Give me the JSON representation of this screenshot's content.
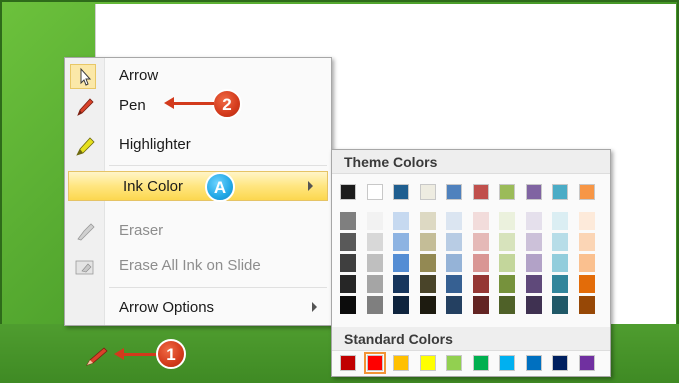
{
  "menu": {
    "items": [
      {
        "label": "Arrow",
        "icon": "arrow-pointer-icon",
        "disabled": false
      },
      {
        "label": "Pen",
        "icon": "pen-icon",
        "disabled": false
      },
      {
        "label": "Highlighter",
        "icon": "highlighter-icon",
        "disabled": false
      },
      {
        "label": "Ink Color",
        "icon": "",
        "disabled": false,
        "submenu": true
      },
      {
        "label": "Eraser",
        "icon": "eraser-icon",
        "disabled": true
      },
      {
        "label": "Erase All Ink on Slide",
        "icon": "erase-all-icon",
        "disabled": true
      },
      {
        "label": "Arrow Options",
        "icon": "",
        "disabled": false,
        "submenu": true
      }
    ]
  },
  "color_panel": {
    "theme_title": "Theme Colors",
    "standard_title": "Standard Colors",
    "theme_top": [
      "#1b1b1b",
      "#ffffff",
      "#1f5e8f",
      "#eeece1",
      "#4f81bd",
      "#c0504d",
      "#9bbb59",
      "#8064a2",
      "#4bacc6",
      "#f79646"
    ],
    "theme_shades": [
      [
        "#7f7f7f",
        "#595959",
        "#3f3f3f",
        "#262626",
        "#0c0c0c"
      ],
      [
        "#f2f2f2",
        "#d8d8d8",
        "#bfbfbf",
        "#a5a5a5",
        "#7f7f7f"
      ],
      [
        "#c6d9f0",
        "#8db3e2",
        "#548dd4",
        "#17365d",
        "#0f243e"
      ],
      [
        "#ddd9c3",
        "#c4bd97",
        "#938953",
        "#494429",
        "#1d1b10"
      ],
      [
        "#dbe5f1",
        "#b8cce4",
        "#95b3d7",
        "#366092",
        "#244061"
      ],
      [
        "#f2dcdb",
        "#e5b9b7",
        "#d99694",
        "#953734",
        "#632423"
      ],
      [
        "#ebf1dd",
        "#d7e3bc",
        "#c3d69b",
        "#76923c",
        "#4f6128"
      ],
      [
        "#e5e0ec",
        "#ccc1d9",
        "#b2a2c7",
        "#5f497a",
        "#3f3151"
      ],
      [
        "#dbeef3",
        "#b7dde8",
        "#92cddc",
        "#31859b",
        "#205867"
      ],
      [
        "#fdeada",
        "#fbd5b5",
        "#fac08f",
        "#e36c09",
        "#974806"
      ]
    ],
    "standard": [
      "#c00000",
      "#ff0000",
      "#ffc000",
      "#ffff00",
      "#92d050",
      "#00b050",
      "#00b0f0",
      "#0070c0",
      "#002060",
      "#7030a0"
    ],
    "standard_selected_index": 1
  },
  "callouts": {
    "one": "1",
    "two": "2",
    "a": "A"
  }
}
